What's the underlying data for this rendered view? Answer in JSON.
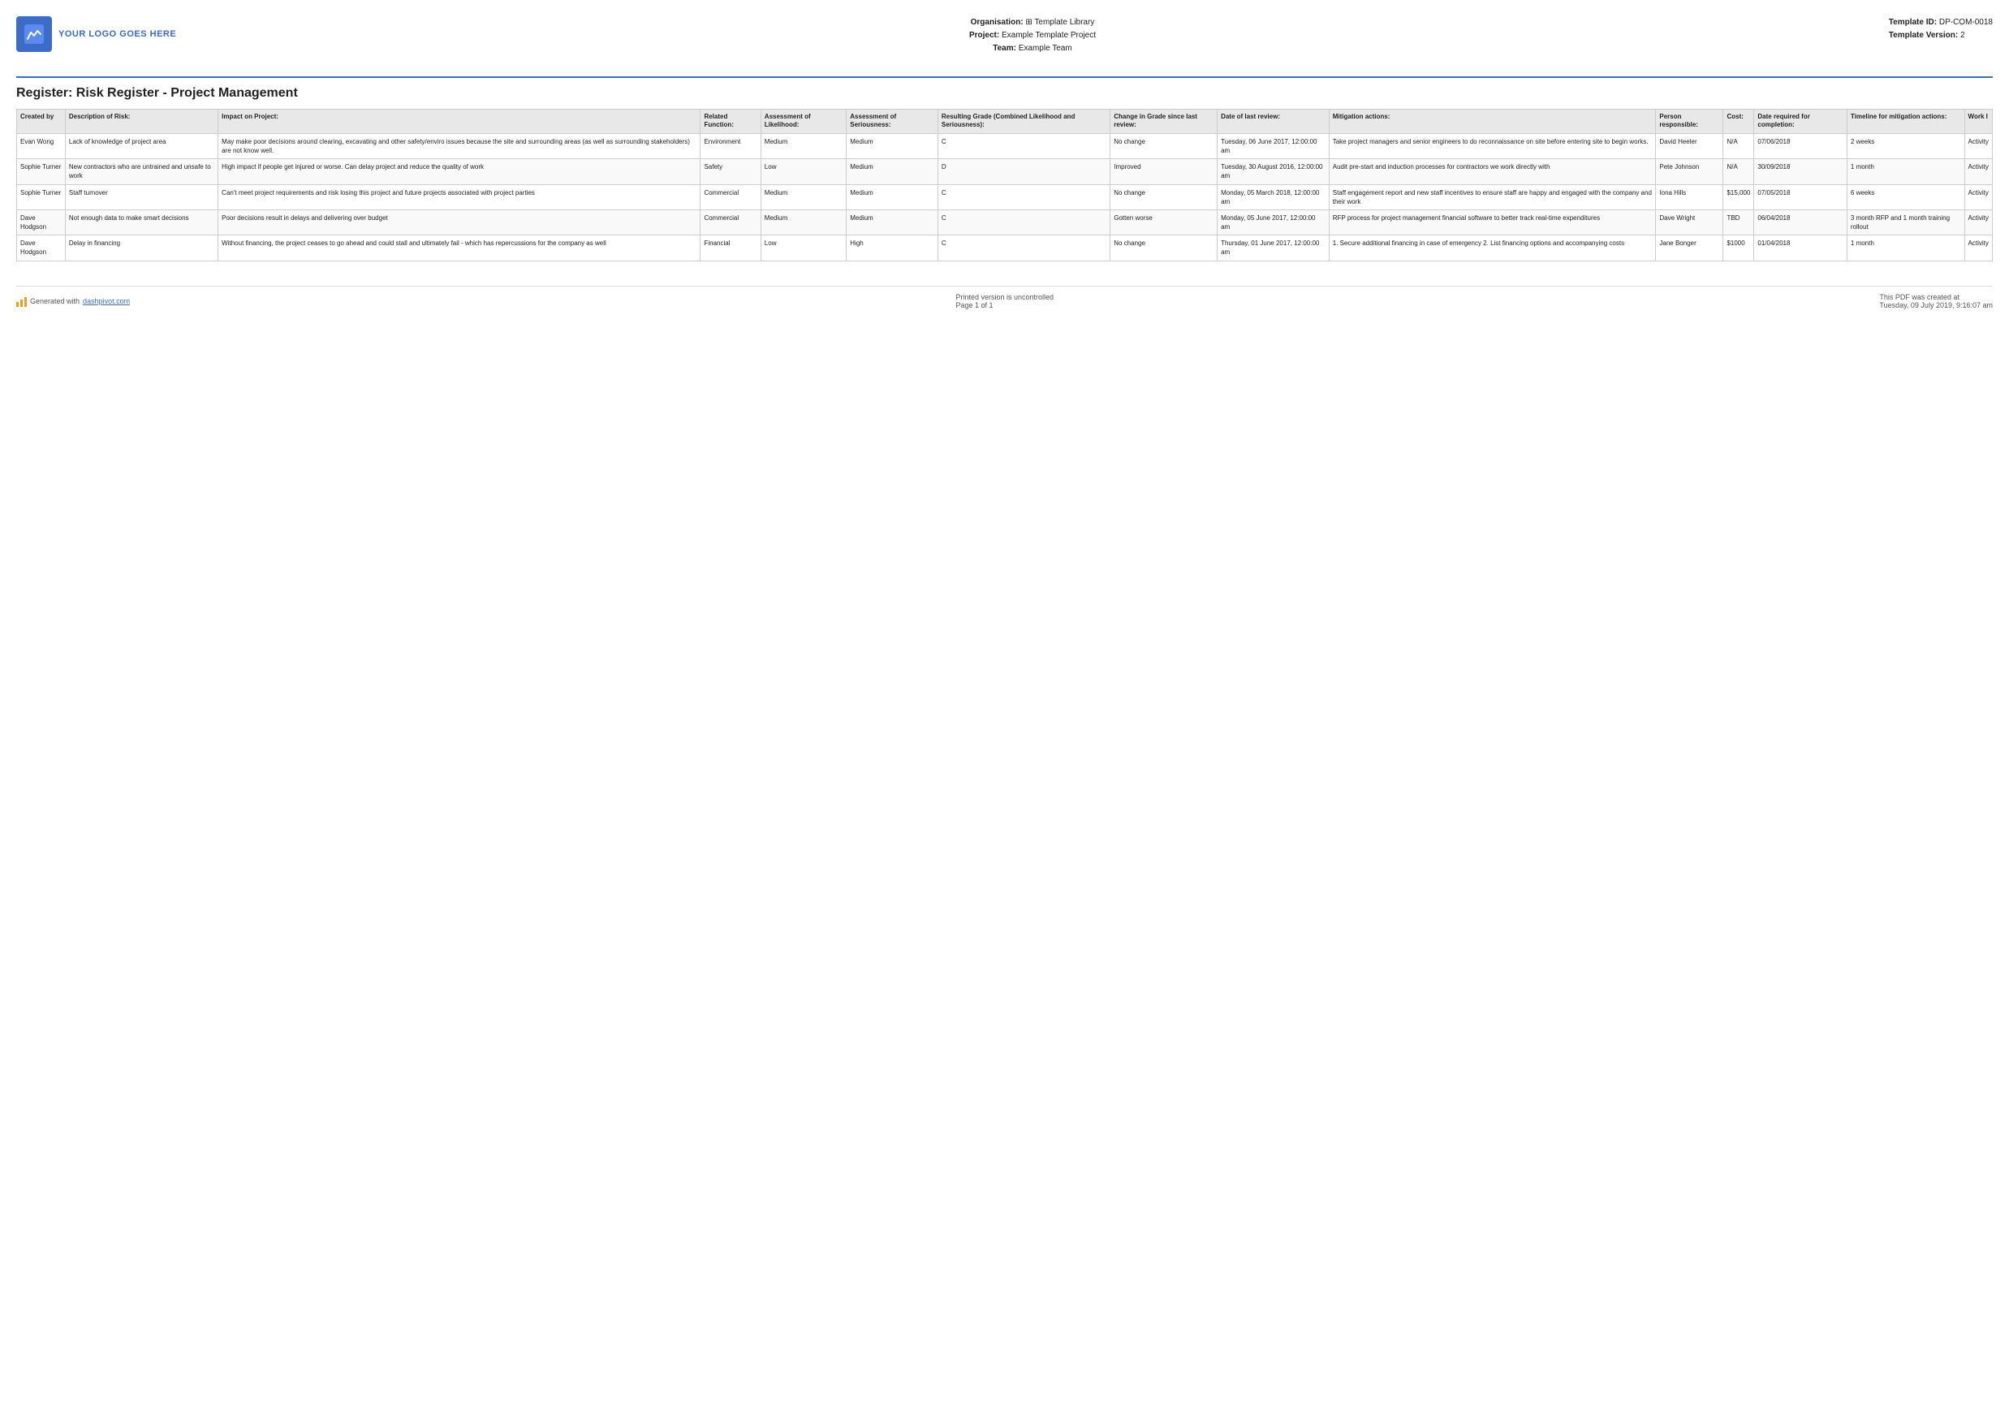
{
  "header": {
    "logo_text": "YOUR LOGO GOES HERE",
    "org_label": "Organisation:",
    "org_value": "⊞ Template Library",
    "project_label": "Project:",
    "project_value": "Example Template Project",
    "team_label": "Team:",
    "team_value": "Example Team",
    "template_id_label": "Template ID:",
    "template_id_value": "DP-COM-0018",
    "template_version_label": "Template Version:",
    "template_version_value": "2"
  },
  "page_title": "Register: Risk Register - Project Management",
  "table": {
    "columns": [
      "Created by",
      "Description of Risk:",
      "Impact on Project:",
      "Related Function:",
      "Assessment of Likelihood:",
      "Assessment of Seriousness:",
      "Resulting Grade (Combined Likelihood and Seriousness):",
      "Change in Grade since last review:",
      "Date of last review:",
      "Mitigation actions:",
      "Person responsible:",
      "Cost:",
      "Date required for completion:",
      "Timeline for mitigation actions:",
      "Work I"
    ],
    "rows": [
      {
        "created_by": "Evan Wong",
        "description": "Lack of knowledge of project area",
        "impact": "May make poor decisions around clearing, excavating and other safety/enviro issues because the site and surrounding areas (as well as surrounding stakeholders) are not know well.",
        "function": "Environment",
        "likelihood": "Medium",
        "seriousness": "Medium",
        "grade": "C",
        "change": "No change",
        "date_review": "Tuesday, 06 June 2017, 12:00:00 am",
        "mitigation": "Take project managers and senior engineers to do reconnaissance on site before entering site to begin works.",
        "person": "David Heeler",
        "cost": "N/A",
        "date_completion": "07/06/2018",
        "timeline": "2 weeks",
        "work": "Activity"
      },
      {
        "created_by": "Sophie Turner",
        "description": "New contractors who are untrained and unsafe to work",
        "impact": "High impact if people get injured or worse. Can delay project and reduce the quality of work",
        "function": "Safety",
        "likelihood": "Low",
        "seriousness": "Medium",
        "grade": "D",
        "change": "Improved",
        "date_review": "Tuesday, 30 August 2016, 12:00:00 am",
        "mitigation": "Audit pre-start and induction processes for contractors we work directly with",
        "person": "Pete Johnson",
        "cost": "N/A",
        "date_completion": "30/09/2018",
        "timeline": "1 month",
        "work": "Activity"
      },
      {
        "created_by": "Sophie Turner",
        "description": "Staff turnover",
        "impact": "Can't meet project requirements and risk losing this project and future projects associated with project parties",
        "function": "Commercial",
        "likelihood": "Medium",
        "seriousness": "Medium",
        "grade": "C",
        "change": "No change",
        "date_review": "Monday, 05 March 2018, 12:00:00 am",
        "mitigation": "Staff engagement report and new staff incentives to ensure staff are happy and engaged with the company and their work",
        "person": "Iona Hills",
        "cost": "$15,000",
        "date_completion": "07/05/2018",
        "timeline": "6 weeks",
        "work": "Activity"
      },
      {
        "created_by": "Dave Hodgson",
        "description": "Not enough data to make smart decisions",
        "impact": "Poor decisions result in delays and delivering over budget",
        "function": "Commercial",
        "likelihood": "Medium",
        "seriousness": "Medium",
        "grade": "C",
        "change": "Gotten worse",
        "date_review": "Monday, 05 June 2017, 12:00:00 am",
        "mitigation": "RFP process for project management financial software to better track real-time expenditures",
        "person": "Dave Wright",
        "cost": "TBD",
        "date_completion": "06/04/2018",
        "timeline": "3 month RFP and 1 month training rollout",
        "work": "Activity"
      },
      {
        "created_by": "Dave Hodgson",
        "description": "Delay in financing",
        "impact": "Without financing, the project ceases to go ahead and could stall and ultimately fail - which has repercussions for the company as well",
        "function": "Financial",
        "likelihood": "Low",
        "seriousness": "High",
        "grade": "C",
        "change": "No change",
        "date_review": "Thursday, 01 June 2017, 12:00:00 am",
        "mitigation": "1. Secure additional financing in case of emergency\n2. List financing options and accompanying costs",
        "person": "Jane Bonger",
        "cost": "$1000",
        "date_completion": "01/04/2018",
        "timeline": "1 month",
        "work": "Activity"
      }
    ]
  },
  "footer": {
    "generated_text": "Generated with ",
    "dashpivot_link": "dashpivot.com",
    "center_text": "Printed version is uncontrolled",
    "page_text": "Page 1 of 1",
    "right_text": "This PDF was created at",
    "right_date": "Tuesday, 09 July 2019, 9:16:07 am"
  }
}
